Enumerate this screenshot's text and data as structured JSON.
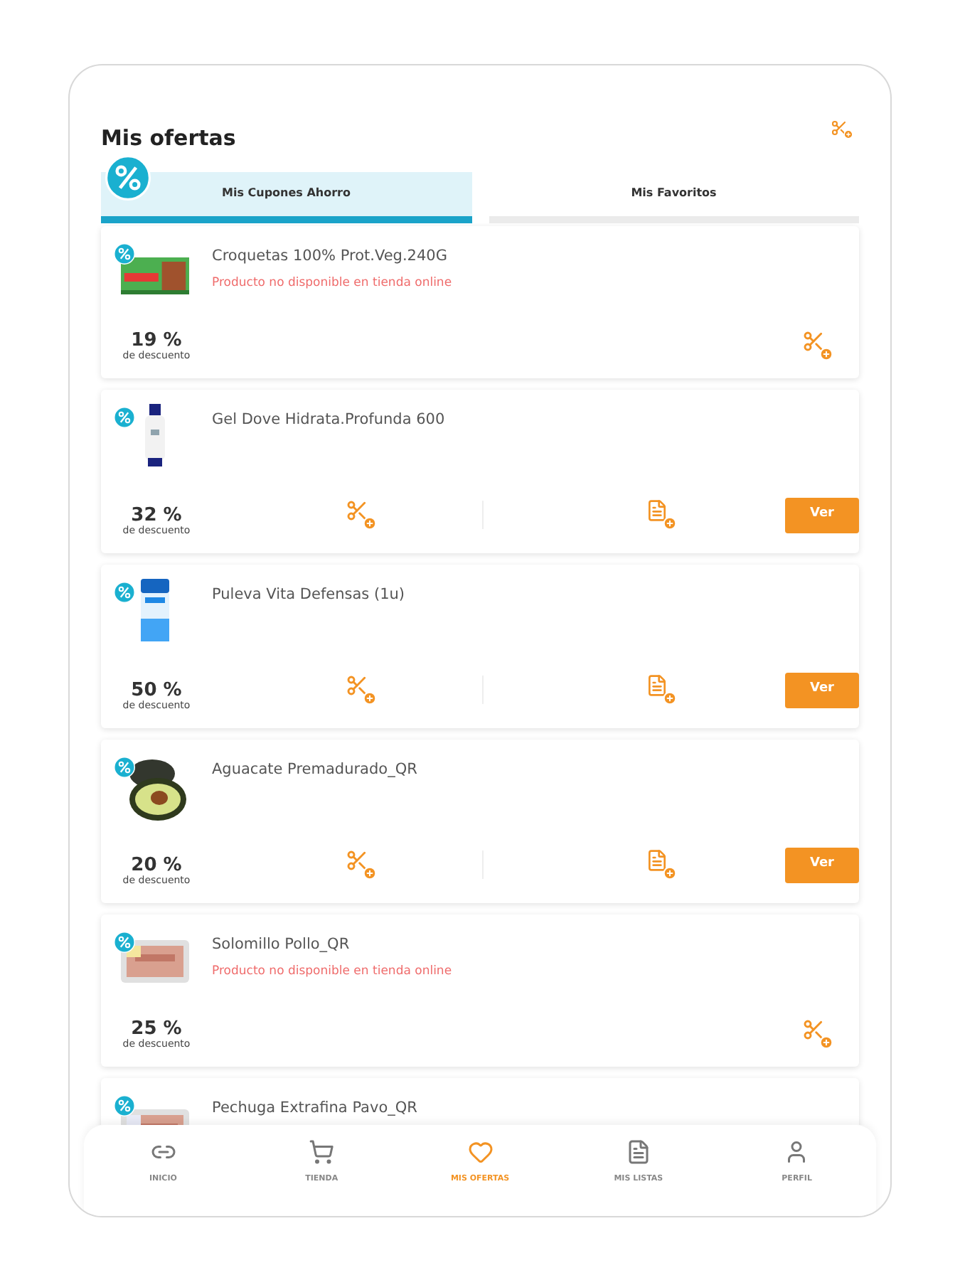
{
  "header": {
    "title": "Mis ofertas"
  },
  "tabs": [
    {
      "label": "Mis Cupones Ahorro",
      "selected": true
    },
    {
      "label": "Mis Favoritos",
      "selected": false
    }
  ],
  "offers": [
    {
      "kind": "unavailable",
      "name": "Croquetas 100% Prot.Veg.240G",
      "note": "Producto no disponible en tienda online",
      "discount": "19 %",
      "discount_label": "de descuento"
    },
    {
      "kind": "available",
      "name": "Gel Dove Hidrata.Profunda 600",
      "discount": "32 %",
      "discount_label": "de descuento",
      "button": "Ver"
    },
    {
      "kind": "available",
      "name": "Puleva Vita Defensas (1u)",
      "discount": "50 %",
      "discount_label": "de descuento",
      "button": "Ver"
    },
    {
      "kind": "available",
      "name": "Aguacate Premadurado_QR",
      "discount": "20 %",
      "discount_label": "de descuento",
      "button": "Ver"
    },
    {
      "kind": "unavailable",
      "name": "Solomillo Pollo_QR",
      "note": "Producto no disponible en tienda online",
      "discount": "25 %",
      "discount_label": "de descuento"
    },
    {
      "kind": "partial",
      "name": "Pechuga Extrafina Pavo_QR"
    }
  ],
  "nav": [
    {
      "label": "INICIO",
      "selected": false
    },
    {
      "label": "TIENDA",
      "selected": false
    },
    {
      "label": "MIS OFERTAS",
      "selected": true
    },
    {
      "label": "MIS LISTAS",
      "selected": false
    },
    {
      "label": "PERFIL",
      "selected": false
    }
  ]
}
